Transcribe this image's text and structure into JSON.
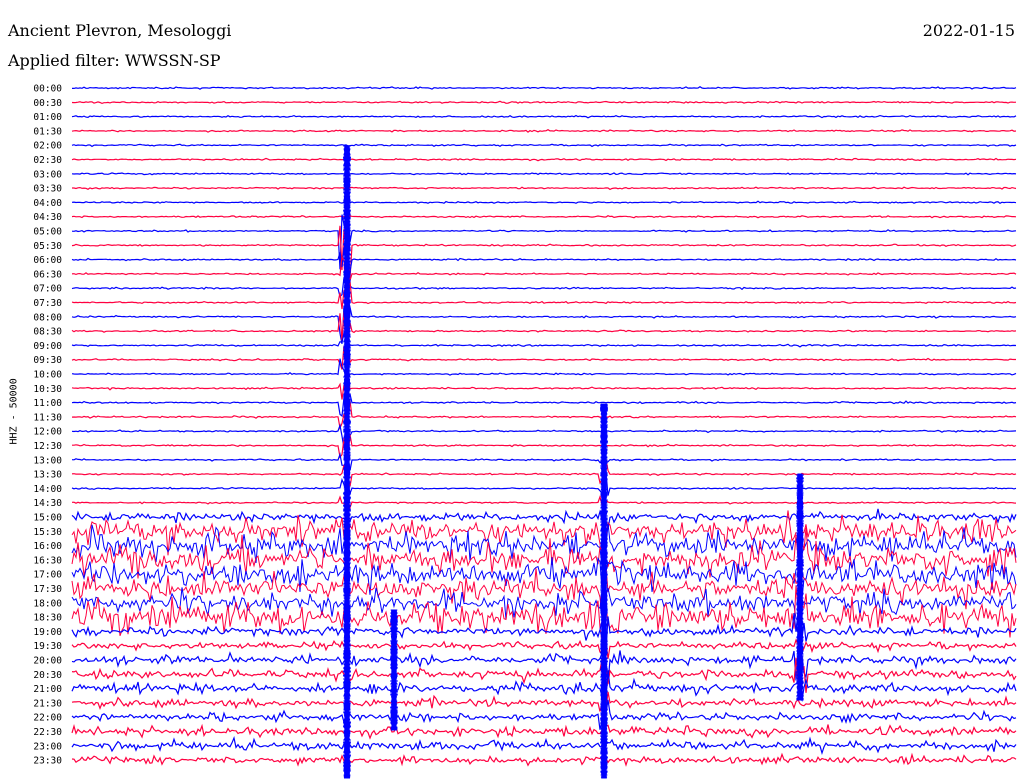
{
  "header": {
    "station": "Ancient Plevron, Mesologgi",
    "date": "2022-01-15",
    "filter": "Applied filter: WWSSN-SP"
  },
  "chart_data": {
    "type": "line",
    "ylabel": "HHZ - 50000",
    "colors": [
      "#0000ff",
      "#ff0040"
    ],
    "rows": [
      "00:00",
      "00:30",
      "01:00",
      "01:30",
      "02:00",
      "02:30",
      "03:00",
      "03:30",
      "04:00",
      "04:30",
      "05:00",
      "05:30",
      "06:00",
      "06:30",
      "07:00",
      "07:30",
      "08:00",
      "08:30",
      "09:00",
      "09:30",
      "10:00",
      "10:30",
      "11:00",
      "11:30",
      "12:00",
      "12:30",
      "13:00",
      "13:30",
      "14:00",
      "14:30",
      "15:00",
      "15:30",
      "16:00",
      "16:30",
      "17:00",
      "17:30",
      "18:00",
      "18:30",
      "19:00",
      "19:30",
      "20:00",
      "20:30",
      "21:00",
      "21:30",
      "22:00",
      "22:30",
      "23:00",
      "23:30"
    ]
  }
}
